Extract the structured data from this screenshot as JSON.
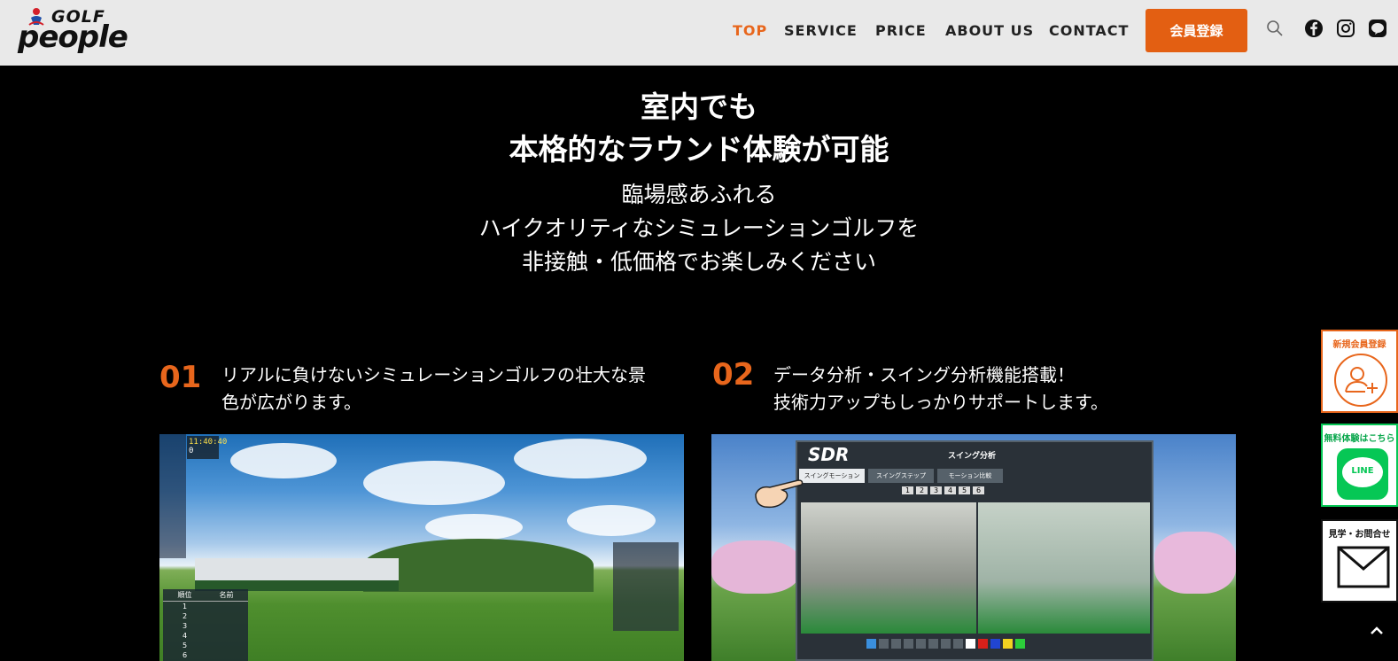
{
  "brand": {
    "top": "GOLF",
    "bottom": "people"
  },
  "nav": {
    "items": [
      {
        "label": "TOP",
        "active": true
      },
      {
        "label": "SERVICE",
        "active": false
      },
      {
        "label": "PRICE",
        "active": false
      },
      {
        "label": "ABOUT US",
        "active": false
      },
      {
        "label": "CONTACT",
        "active": false
      }
    ],
    "join_button": "会員登録",
    "icons": [
      "search-icon",
      "facebook-icon",
      "instagram-icon",
      "line-icon"
    ]
  },
  "hero": {
    "title_lines": [
      "室内でも",
      "本格的なラウンド体験が可能"
    ],
    "sub_lines": [
      "臨場感あふれる",
      "ハイクオリティなシミュレーションゴルフを",
      "非接触・低価格でお楽しみください"
    ]
  },
  "features": [
    {
      "number": "01",
      "lines": [
        "リアルに負けないシミュレーションゴルフの壮大な景",
        "色が広がります。"
      ]
    },
    {
      "number": "02",
      "lines": [
        "データ分析・スイング分析機能搭載！",
        "技術力アップもしっかりサポートします。"
      ]
    }
  ],
  "screen1": {
    "time": "11:40:40",
    "count": "0",
    "table_headers": [
      "順位",
      "名前"
    ],
    "table_rows": [
      "1",
      "2",
      "3",
      "4",
      "5",
      "6"
    ]
  },
  "screen2": {
    "logo": "SDR",
    "title": "スイング分析",
    "tabs": [
      "スイングモーション",
      "スイングステップ",
      "モーション比較"
    ],
    "steps": [
      "1",
      "2",
      "3",
      "4",
      "5",
      "6"
    ]
  },
  "side": {
    "register_label": "新規会員登録",
    "line_label": "無料体験はこちら",
    "line_text": "LINE",
    "contact_label": "見学・お問合せ"
  },
  "colors": {
    "accent": "#e8661c",
    "button": "#e35f12",
    "line_green": "#06c755",
    "header_bg": "#e9e9e9"
  }
}
